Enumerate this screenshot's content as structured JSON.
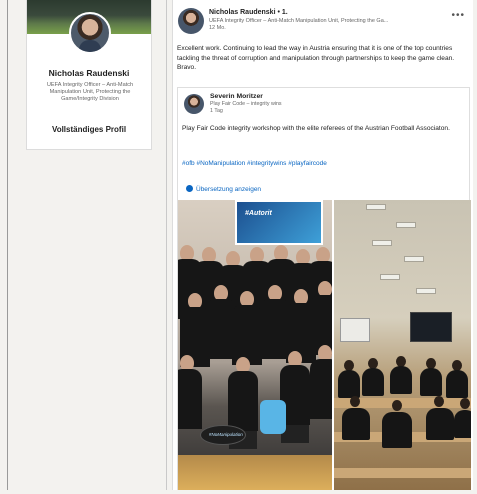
{
  "profile": {
    "name": "Nicholas Raudenski",
    "headline": "UEFA Integrity Officer – Anti-Match Manipulation Unit, Protecting the Game/Integrity Division",
    "view_profile": "Vollständiges Profil"
  },
  "post": {
    "author_name": "Nicholas Raudenski • 1.",
    "author_headline": "UEFA Integrity Officer – Anti-Match Manipulation Unit, Protecting the Ga...",
    "time": "12 Mo.",
    "more_icon": "more-horizontal-icon",
    "text": "Excellent work. Continuing to lead the way in Austria ensuring that it is one of the top countries tackling the threat of corruption and manipulation through partnerships to keep the game clean. Bravo."
  },
  "shared": {
    "author_name": "Severin Moritzer",
    "author_headline": "Play Fair Code – integrity wins",
    "time": "1 Tag",
    "text": "Play Fair Code integrity workshop with the elite referees of the Austrian Football Associaton.",
    "hashtags": "#ofb #NoManipulation #integritywins #playfaircode",
    "translate": "Übersetzung anzeigen"
  },
  "photos": {
    "screen_text": "#Autorit",
    "sign_text": "#NoManipulation"
  },
  "colors": {
    "link": "#0a66c2",
    "background": "#f3f2ef",
    "card": "#ffffff"
  }
}
